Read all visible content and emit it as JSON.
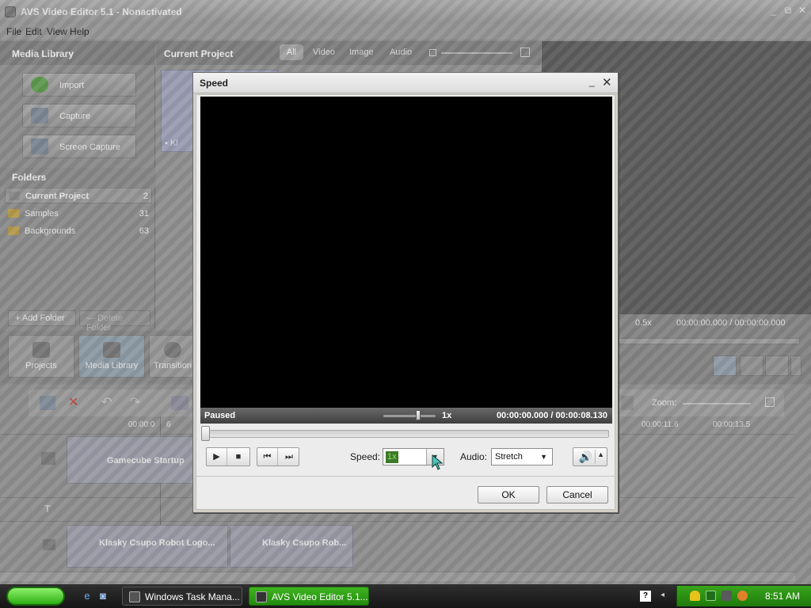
{
  "app": {
    "title": "AVS Video Editor 5.1 - Nonactivated",
    "window_controls": {
      "minimize": "_",
      "restore": "⧉",
      "close": "✕"
    },
    "menu": [
      "File",
      "Edit",
      "View",
      "Help"
    ],
    "media_library": {
      "title": "Media Library",
      "buttons": [
        "Import",
        "Capture",
        "Screen Capture"
      ],
      "folders_title": "Folders",
      "folders": [
        {
          "name": "Current Project",
          "count": "2"
        },
        {
          "name": "Samples",
          "count": "31"
        },
        {
          "name": "Backgrounds",
          "count": "63"
        }
      ],
      "add_folder": "Add Folder",
      "delete_folder": "Delete Folder"
    },
    "current_project": {
      "title": "Current Project",
      "filters": [
        "All",
        "Video",
        "Image",
        "Audio"
      ],
      "clip_label": "Kl"
    },
    "preview": {
      "rate": "0.5x",
      "time": "00:00:00.000 / 00:00:00.000"
    },
    "tabs": [
      "Projects",
      "Media Library",
      "Transition"
    ],
    "timeline": {
      "ruler": [
        "00:00:0",
        "6",
        "00:00:11.6",
        "00:00:13.5"
      ],
      "zoom_label": "Zoom:",
      "clips": [
        "Gamecube Startup",
        "Klasky Csupo Robot Logo...",
        "Klasky Csupo Rob..."
      ]
    }
  },
  "dialog": {
    "title": "Speed",
    "status": "Paused",
    "rate": "1x",
    "time": "00:00:00.000 / 00:00:08.130",
    "speed_label": "Speed:",
    "speed_value": "1x",
    "audio_label": "Audio:",
    "audio_value": "Stretch",
    "ok": "OK",
    "cancel": "Cancel"
  },
  "taskbar": {
    "items": [
      "Windows Task Mana...",
      "AVS Video Editor 5.1..."
    ],
    "clock": "8:51 AM"
  },
  "colors": {
    "accent_green": "#2eae13",
    "speed_highlight": "#3d7a28"
  }
}
